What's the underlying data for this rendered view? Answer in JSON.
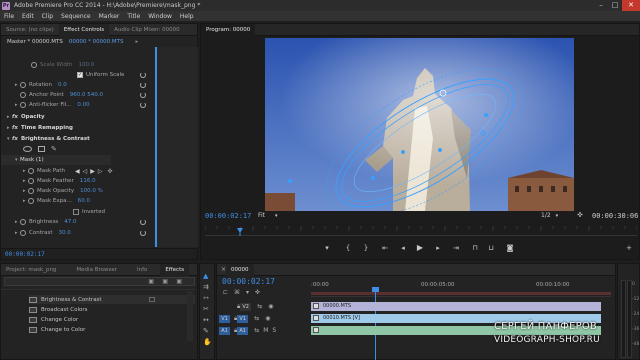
{
  "window": {
    "title": "Adobe Premiere Pro CC 2014 - H:\\Adobe\\Premiere\\mask_png *",
    "app_icon": "Pr",
    "minimize": "–",
    "maximize": "□",
    "close": "✕"
  },
  "menu": [
    "File",
    "Edit",
    "Clip",
    "Sequence",
    "Marker",
    "Title",
    "Window",
    "Help"
  ],
  "source_panel": {
    "tabs": [
      "Source: (no clips)",
      "Effect Controls",
      "Audio Clip Mixer: 00000"
    ],
    "header_master": "Master * 00000.MTS",
    "header_clip": "00000 * 00000.MTS",
    "rows": [
      {
        "label": "Scale Width",
        "value": "100.0",
        "dim": true
      },
      {
        "label": "Uniform Scale",
        "checkbox": true
      },
      {
        "label": "Rotation",
        "value": "0.0"
      },
      {
        "label": "Anchor Point",
        "value": "960.0   540.0"
      },
      {
        "label": "Anti-flicker Fil...",
        "value": "0.00"
      },
      {
        "label": "Opacity",
        "section": true
      },
      {
        "label": "Time Remapping",
        "section": true
      },
      {
        "label": "Brightness & Contrast",
        "section": true
      },
      {
        "label": "Mask (1)"
      },
      {
        "label": "Mask Path"
      },
      {
        "label": "Mask Feather",
        "value": "116.0"
      },
      {
        "label": "Mask Opacity",
        "value": "100.0 %"
      },
      {
        "label": "Mask Expa...",
        "value": "60.0"
      },
      {
        "label": "Inverted",
        "checkbox": true
      },
      {
        "label": "Brightness",
        "value": "47.0"
      },
      {
        "label": "Contrast",
        "value": "30.0"
      }
    ],
    "timecode": "00:00:02:17"
  },
  "program": {
    "tab": "Program: 00000",
    "timecode_left": "00:00:02:17",
    "fit": "Fit",
    "resolution": "1/2",
    "timecode_right": "00:00:30:06"
  },
  "project_panel": {
    "tabs": [
      "Project: mask_png",
      "Media Browser",
      "Info",
      "Effects"
    ],
    "items": [
      "Brightness & Contrast",
      "Broadcast Colors",
      "Change Color",
      "Change to Color"
    ]
  },
  "timeline": {
    "tab": "00000",
    "timecode": "00:00:02:17",
    "ruler": [
      ":00:00",
      "00:00:05:00",
      "00:00:10:00"
    ],
    "tracks": [
      {
        "name": "V2",
        "clip": "00000.MTS"
      },
      {
        "name": "V1",
        "src": "V1",
        "clip": "00010.MTS [V]"
      },
      {
        "name": "A1",
        "src": "A1",
        "clip": ""
      }
    ],
    "meter_labels": [
      "0",
      "-12",
      "-24",
      "-36",
      "-48"
    ]
  },
  "watermark": {
    "line1": "СЕРГЕЙ ПАНФЕРОВ",
    "line2": "VIDEOGRAPH-SHOP.RU"
  },
  "colors": {
    "accent_blue": "#3f8ee6",
    "clip_purple": "#b3b3d9",
    "clip_video": "#9fc9e8",
    "playhead": "#3f8ee6"
  },
  "icons": [
    "pr-logo-icon",
    "stopwatch-icon",
    "reset-icon",
    "play-icon",
    "step-back-icon",
    "step-forward-icon",
    "mark-in-icon",
    "mark-out-icon",
    "export-frame-icon",
    "wrench-icon",
    "snap-icon",
    "link-icon",
    "eye-icon",
    "lock-icon",
    "mic-icon",
    "pen-icon",
    "ellipse-icon",
    "rect-icon"
  ]
}
